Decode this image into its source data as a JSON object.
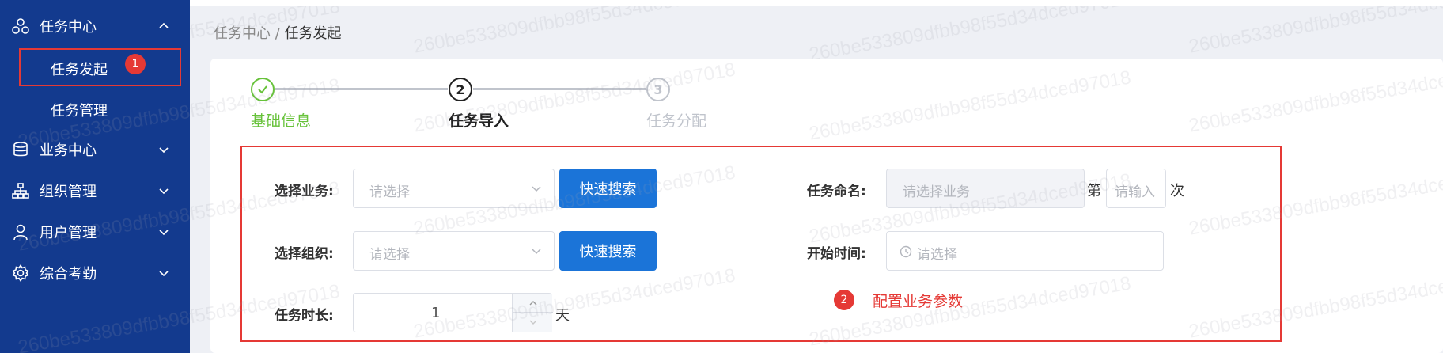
{
  "sidebar": {
    "groups": [
      {
        "label": "任务中心",
        "icon": "network-icon",
        "expanded": true
      },
      {
        "label": "业务中心",
        "icon": "database-icon"
      },
      {
        "label": "组织管理",
        "icon": "org-chart-icon"
      },
      {
        "label": "用户管理",
        "icon": "user-icon"
      },
      {
        "label": "综合考勤",
        "icon": "gear-icon"
      }
    ],
    "sub_items": [
      {
        "label": "任务发起",
        "active": true
      },
      {
        "label": "任务管理"
      }
    ],
    "badge": "1"
  },
  "breadcrumb": {
    "parent": "任务中心",
    "separator": " / ",
    "current": "任务发起"
  },
  "steps": [
    {
      "number": "✓",
      "title": "基础信息",
      "status": "done"
    },
    {
      "number": "2",
      "title": "任务导入",
      "status": "current"
    },
    {
      "number": "3",
      "title": "任务分配",
      "status": "pending"
    }
  ],
  "form": {
    "business": {
      "label": "选择业务:",
      "placeholder": "请选择",
      "button": "快速搜索"
    },
    "org": {
      "label": "选择组织:",
      "placeholder": "请选择",
      "button": "快速搜索"
    },
    "duration": {
      "label": "任务时长:",
      "value": "1",
      "unit": "天"
    },
    "task_name": {
      "label": "任务命名:",
      "placeholder": "请选择业务",
      "prefix": "第",
      "count_placeholder": "请输入",
      "suffix": "次"
    },
    "start_time": {
      "label": "开始时间:",
      "placeholder": "请选择"
    }
  },
  "annotation": {
    "badge": "2",
    "text": "配置业务参数"
  },
  "watermark": "260be533809dfbb98f55d34dced97018",
  "colors": {
    "sidebar": "#133a8e",
    "primary": "#1b74d8",
    "success": "#67c23a",
    "highlight": "#e53935"
  }
}
